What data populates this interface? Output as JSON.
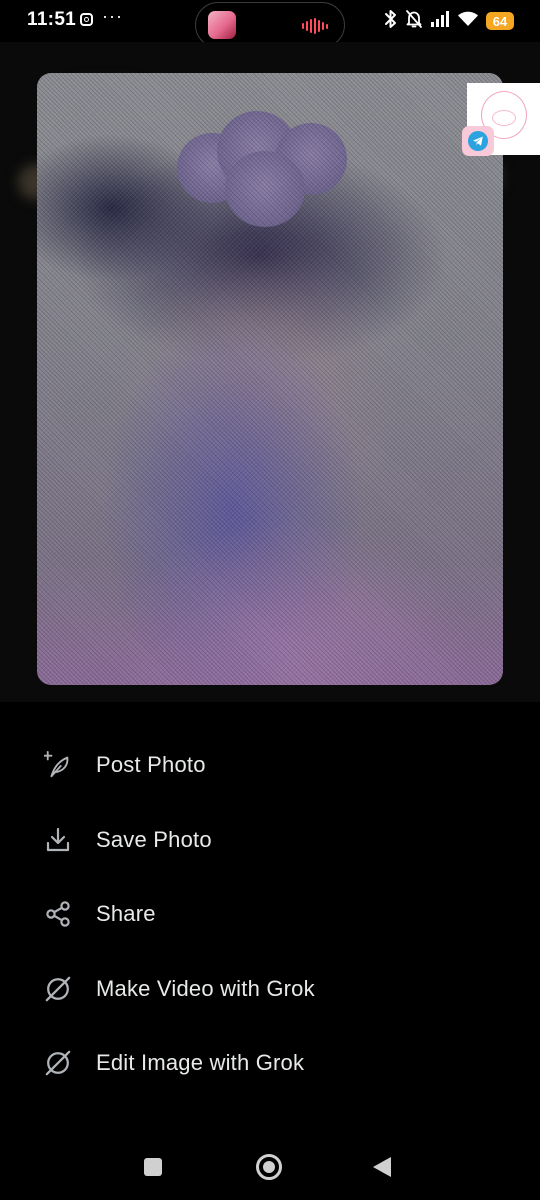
{
  "status_bar": {
    "time": "11:51",
    "more_indicator": "···",
    "battery": "64",
    "icons": [
      "instagram-icon",
      "bluetooth-icon",
      "mute-icon",
      "signal-icon",
      "wifi-icon",
      "battery-icon"
    ]
  },
  "colors": {
    "background": "#000000",
    "text": "#e7e9ea",
    "icon": "#b0b4b8",
    "battery": "#f5a623",
    "telegram": "#2aa3de",
    "widget_badge": "#f7c9d9"
  },
  "preview": {
    "icon": "blurred-photo"
  },
  "overlay_widget": {
    "icon": "telegram-icon"
  },
  "actions": [
    {
      "label": "Post Photo",
      "icon": "post-photo-icon"
    },
    {
      "label": "Save Photo",
      "icon": "download-icon"
    },
    {
      "label": "Share",
      "icon": "share-icon"
    },
    {
      "label": "Make Video with Grok",
      "icon": "grok-icon"
    },
    {
      "label": "Edit Image with Grok",
      "icon": "grok-icon"
    }
  ],
  "nav_bar": {
    "icons": [
      "recents-icon",
      "home-icon",
      "back-icon"
    ]
  }
}
